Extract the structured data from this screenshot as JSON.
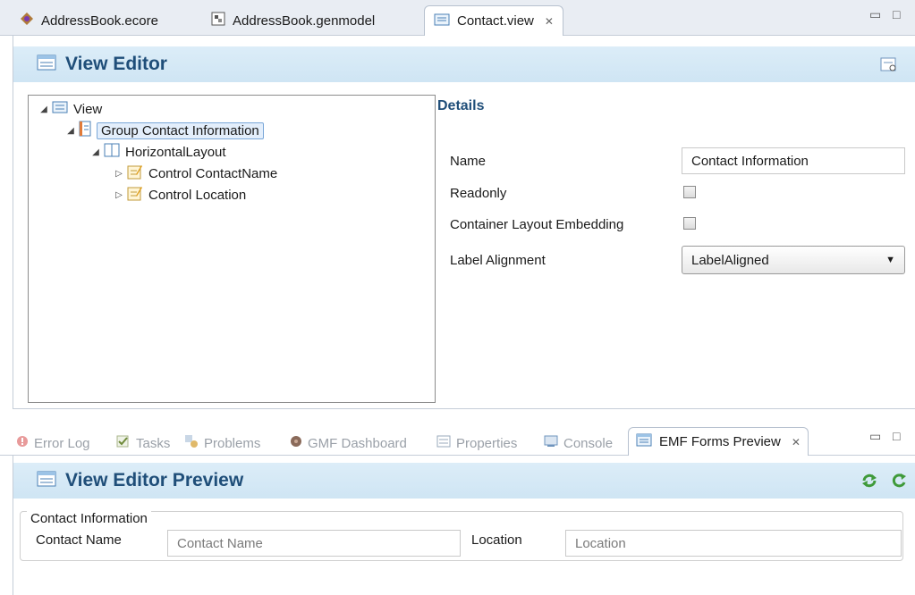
{
  "editor_tabs": [
    {
      "label": "AddressBook.ecore",
      "icon": "ecore-package-icon"
    },
    {
      "label": "AddressBook.genmodel",
      "icon": "genmodel-icon"
    },
    {
      "label": "Contact.view",
      "icon": "view-file-icon",
      "active": true,
      "close": "✕"
    }
  ],
  "view_editor": {
    "title": "View Editor",
    "tree": [
      {
        "label": "View",
        "level": 0,
        "expanded": true,
        "icon": "view-icon"
      },
      {
        "label": "Group Contact Information",
        "level": 1,
        "expanded": true,
        "icon": "group-icon",
        "selected": true
      },
      {
        "label": "HorizontalLayout",
        "level": 2,
        "expanded": true,
        "icon": "horizontal-layout-icon"
      },
      {
        "label": "Control ContactName",
        "level": 3,
        "expanded": false,
        "icon": "control-icon"
      },
      {
        "label": "Control Location",
        "level": 3,
        "expanded": false,
        "icon": "control-icon"
      }
    ],
    "details": {
      "title": "Details",
      "name_label": "Name",
      "name_value": "Contact Information",
      "readonly_label": "Readonly",
      "readonly_checked": false,
      "container_label": "Container Layout Embedding",
      "container_checked": false,
      "alignment_label": "Label Alignment",
      "alignment_value": "LabelAligned"
    }
  },
  "view_tabs": [
    {
      "label": "Error Log",
      "icon": "error-log-icon"
    },
    {
      "label": "Tasks",
      "icon": "tasks-icon"
    },
    {
      "label": "Problems",
      "icon": "problems-icon"
    },
    {
      "label": "GMF Dashboard",
      "icon": "gmf-dashboard-icon"
    },
    {
      "label": "Properties",
      "icon": "properties-icon"
    },
    {
      "label": "Console",
      "icon": "console-icon"
    },
    {
      "label": "EMF Forms Preview",
      "icon": "emf-forms-preview-icon",
      "active": true,
      "close": "✕"
    }
  ],
  "preview": {
    "title": "View Editor Preview",
    "group_label": "Contact Information",
    "contact_name_label": "Contact Name",
    "contact_name_placeholder": "Contact Name",
    "location_label": "Location",
    "location_placeholder": "Location"
  },
  "window_controls": {
    "minimize": "▭",
    "maximize": "□"
  },
  "colors": {
    "accent": "#1f4e79",
    "banner": "#d6eaf7",
    "tabstrip": "#e9edf3"
  }
}
